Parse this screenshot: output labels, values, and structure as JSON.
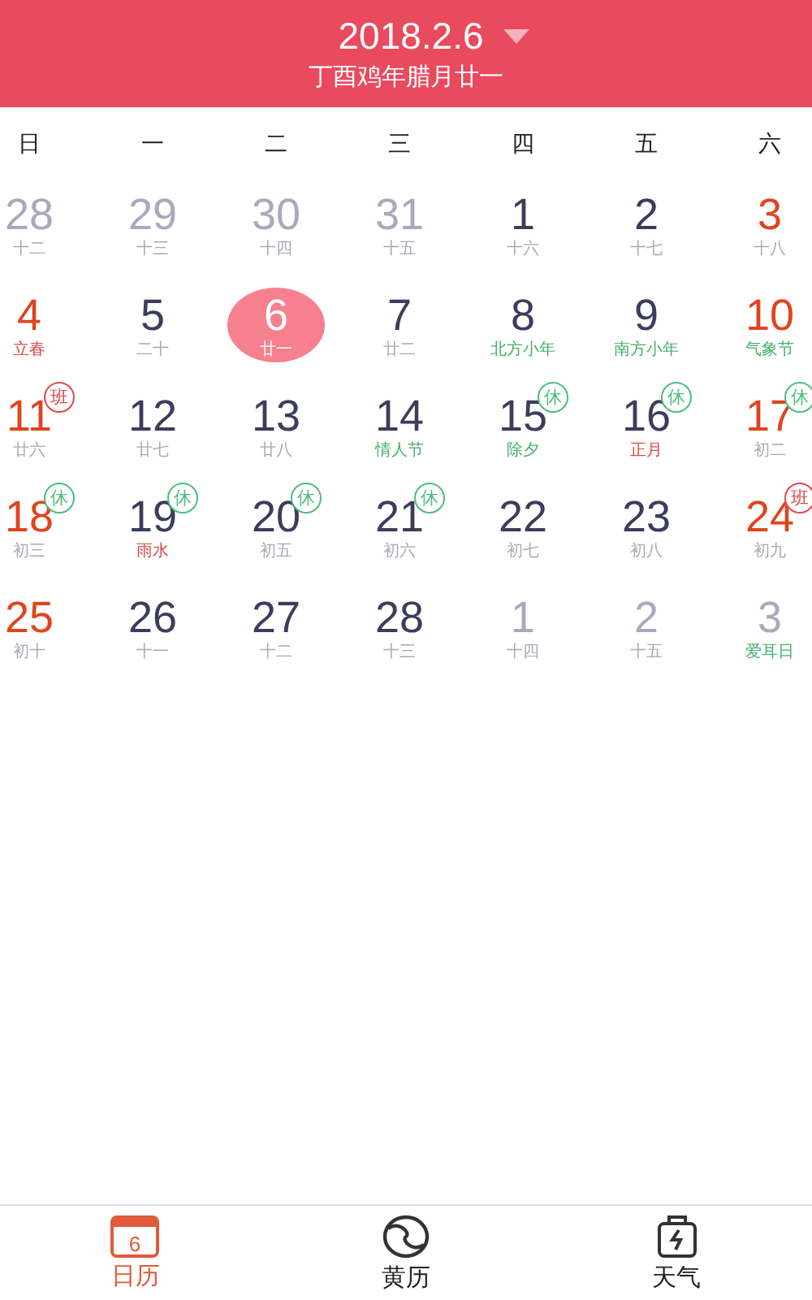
{
  "header": {
    "date": "2018.2.6",
    "lunar": "丁酉鸡年腊月廿一"
  },
  "weekdays": [
    "日",
    "一",
    "二",
    "三",
    "四",
    "五",
    "六"
  ],
  "weeks": [
    [
      {
        "day": "28",
        "lunar": {
          "text": "十二",
          "kind": "plain"
        },
        "kind": "other",
        "selected": false
      },
      {
        "day": "29",
        "lunar": {
          "text": "十三",
          "kind": "plain"
        },
        "kind": "other",
        "selected": false
      },
      {
        "day": "30",
        "lunar": {
          "text": "十四",
          "kind": "plain"
        },
        "kind": "other",
        "selected": false
      },
      {
        "day": "31",
        "lunar": {
          "text": "十五",
          "kind": "plain"
        },
        "kind": "other",
        "selected": false
      },
      {
        "day": "1",
        "lunar": {
          "text": "十六",
          "kind": "plain"
        },
        "kind": "normal",
        "selected": false
      },
      {
        "day": "2",
        "lunar": {
          "text": "十七",
          "kind": "plain"
        },
        "kind": "normal",
        "selected": false
      },
      {
        "day": "3",
        "lunar": {
          "text": "十八",
          "kind": "plain"
        },
        "kind": "weekend",
        "selected": false
      }
    ],
    [
      {
        "day": "4",
        "lunar": {
          "text": "立春",
          "kind": "term"
        },
        "kind": "weekend",
        "selected": false
      },
      {
        "day": "5",
        "lunar": {
          "text": "二十",
          "kind": "plain"
        },
        "kind": "normal",
        "selected": false
      },
      {
        "day": "6",
        "lunar": {
          "text": "廿一",
          "kind": "plain"
        },
        "kind": "normal",
        "selected": true
      },
      {
        "day": "7",
        "lunar": {
          "text": "廿二",
          "kind": "plain"
        },
        "kind": "normal",
        "selected": false
      },
      {
        "day": "8",
        "lunar": {
          "text": "北方小年",
          "kind": "festival"
        },
        "kind": "normal",
        "selected": false
      },
      {
        "day": "9",
        "lunar": {
          "text": "南方小年",
          "kind": "festival"
        },
        "kind": "normal",
        "selected": false
      },
      {
        "day": "10",
        "lunar": {
          "text": "气象节",
          "kind": "festival"
        },
        "kind": "weekend",
        "selected": false
      }
    ],
    [
      {
        "day": "11",
        "lunar": {
          "text": "廿六",
          "kind": "plain"
        },
        "kind": "weekend",
        "selected": false,
        "badge": {
          "text": "班",
          "kind": "work"
        }
      },
      {
        "day": "12",
        "lunar": {
          "text": "廿七",
          "kind": "plain"
        },
        "kind": "normal",
        "selected": false
      },
      {
        "day": "13",
        "lunar": {
          "text": "廿八",
          "kind": "plain"
        },
        "kind": "normal",
        "selected": false
      },
      {
        "day": "14",
        "lunar": {
          "text": "情人节",
          "kind": "festival"
        },
        "kind": "normal",
        "selected": false
      },
      {
        "day": "15",
        "lunar": {
          "text": "除夕",
          "kind": "festival"
        },
        "kind": "normal",
        "selected": false,
        "badge": {
          "text": "休",
          "kind": "rest"
        }
      },
      {
        "day": "16",
        "lunar": {
          "text": "正月",
          "kind": "term"
        },
        "kind": "normal",
        "selected": false,
        "badge": {
          "text": "休",
          "kind": "rest"
        }
      },
      {
        "day": "17",
        "lunar": {
          "text": "初二",
          "kind": "plain"
        },
        "kind": "weekend",
        "selected": false,
        "badge": {
          "text": "休",
          "kind": "rest"
        }
      }
    ],
    [
      {
        "day": "18",
        "lunar": {
          "text": "初三",
          "kind": "plain"
        },
        "kind": "weekend",
        "selected": false,
        "badge": {
          "text": "休",
          "kind": "rest"
        }
      },
      {
        "day": "19",
        "lunar": {
          "text": "雨水",
          "kind": "term"
        },
        "kind": "normal",
        "selected": false,
        "badge": {
          "text": "休",
          "kind": "rest"
        }
      },
      {
        "day": "20",
        "lunar": {
          "text": "初五",
          "kind": "plain"
        },
        "kind": "normal",
        "selected": false,
        "badge": {
          "text": "休",
          "kind": "rest"
        }
      },
      {
        "day": "21",
        "lunar": {
          "text": "初六",
          "kind": "plain"
        },
        "kind": "normal",
        "selected": false,
        "badge": {
          "text": "休",
          "kind": "rest"
        }
      },
      {
        "day": "22",
        "lunar": {
          "text": "初七",
          "kind": "plain"
        },
        "kind": "normal",
        "selected": false
      },
      {
        "day": "23",
        "lunar": {
          "text": "初八",
          "kind": "plain"
        },
        "kind": "normal",
        "selected": false
      },
      {
        "day": "24",
        "lunar": {
          "text": "初九",
          "kind": "plain"
        },
        "kind": "weekend",
        "selected": false,
        "badge": {
          "text": "班",
          "kind": "work"
        }
      }
    ],
    [
      {
        "day": "25",
        "lunar": {
          "text": "初十",
          "kind": "plain"
        },
        "kind": "weekend",
        "selected": false
      },
      {
        "day": "26",
        "lunar": {
          "text": "十一",
          "kind": "plain"
        },
        "kind": "normal",
        "selected": false
      },
      {
        "day": "27",
        "lunar": {
          "text": "十二",
          "kind": "plain"
        },
        "kind": "normal",
        "selected": false
      },
      {
        "day": "28",
        "lunar": {
          "text": "十三",
          "kind": "plain"
        },
        "kind": "normal",
        "selected": false
      },
      {
        "day": "1",
        "lunar": {
          "text": "十四",
          "kind": "plain"
        },
        "kind": "other",
        "selected": false
      },
      {
        "day": "2",
        "lunar": {
          "text": "十五",
          "kind": "plain"
        },
        "kind": "other",
        "selected": false
      },
      {
        "day": "3",
        "lunar": {
          "text": "爱耳日",
          "kind": "festival"
        },
        "kind": "other",
        "selected": false
      }
    ]
  ],
  "tabs": [
    {
      "label": "日历",
      "kind": "calendar",
      "icon_text": "6",
      "selected": true
    },
    {
      "label": "黄历",
      "kind": "almanac",
      "selected": false
    },
    {
      "label": "天气",
      "kind": "weather",
      "selected": false
    }
  ]
}
